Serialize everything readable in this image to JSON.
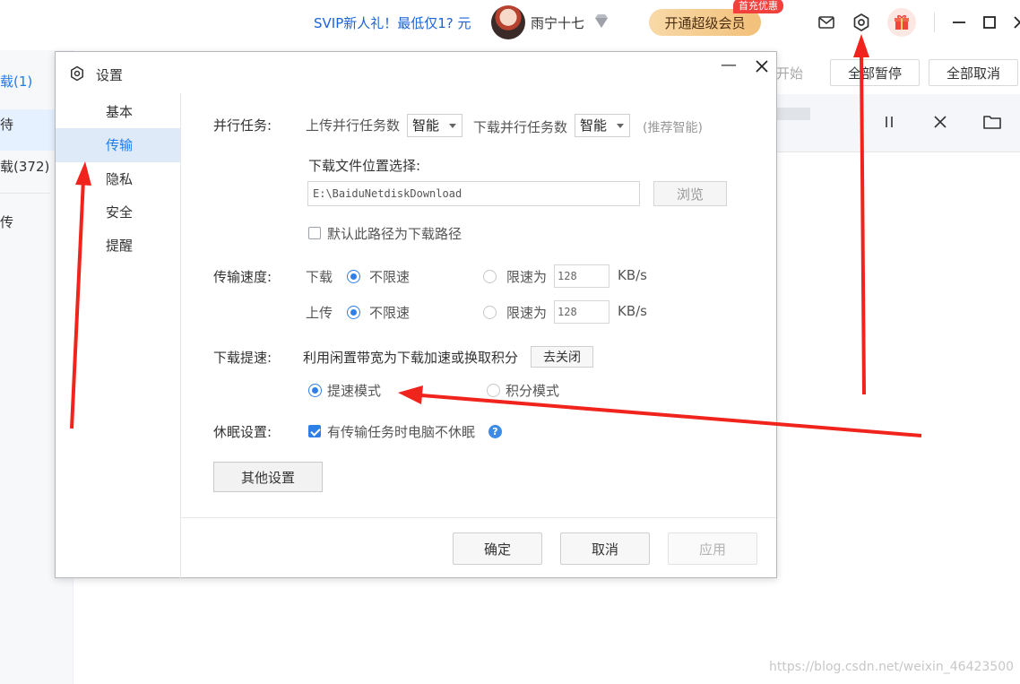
{
  "topbar": {
    "promo_text": "SVIP新人礼！最低仅1? 元",
    "username": "雨宁十七",
    "vip_button_label": "开通超级会员",
    "vip_badge": "首充优惠",
    "icons": [
      "mail-icon",
      "settings-gear-icon",
      "gift-icon",
      "minimize-icon",
      "maximize-icon",
      "close-icon"
    ]
  },
  "main_nav": {
    "fragments": [
      "载(1)",
      "待",
      "载(372)",
      "传"
    ]
  },
  "transfer_toolbar": {
    "start_label": "开始",
    "pause_all_label": "全部暂停",
    "cancel_all_label": "全部取消"
  },
  "dialog": {
    "title": "设置",
    "minimize_glyph": "—",
    "sidebar": [
      {
        "label": "基本",
        "active": false
      },
      {
        "label": "传输",
        "active": true
      },
      {
        "label": "隐私",
        "active": false
      },
      {
        "label": "安全",
        "active": false
      },
      {
        "label": "提醒",
        "active": false
      }
    ],
    "parallel": {
      "label": "并行任务:",
      "upload_label": "上传并行任务数",
      "upload_value": "智能",
      "download_label": "下载并行任务数",
      "download_value": "智能",
      "hint": "(推荐智能)"
    },
    "location": {
      "title": "下载文件位置选择:",
      "path": "E:\\BaiduNetdiskDownload",
      "browse_label": "浏览",
      "default_checkbox_label": "默认此路径为下载路径",
      "default_checked": false
    },
    "speed": {
      "label": "传输速度:",
      "rows": [
        {
          "direction": "下载",
          "unlimited_label": "不限速",
          "limit_label": "限速为",
          "limit_value": "128",
          "unit": "KB/s",
          "unlimited_selected": true
        },
        {
          "direction": "上传",
          "unlimited_label": "不限速",
          "limit_label": "限速为",
          "limit_value": "128",
          "unit": "KB/s",
          "unlimited_selected": true
        }
      ]
    },
    "boost": {
      "label": "下载提速:",
      "description": "利用闲置带宽为下载加速或换取积分",
      "go_close_label": "去关闭",
      "mode_fast_label": "提速模式",
      "mode_points_label": "积分模式",
      "mode_selected": "fast"
    },
    "sleep": {
      "label": "休眠设置:",
      "checkbox_label": "有传输任务时电脑不休眠",
      "checked": true,
      "help_glyph": "?"
    },
    "other_settings_label": "其他设置",
    "footer": {
      "ok_label": "确定",
      "cancel_label": "取消",
      "apply_label": "应用",
      "apply_enabled": false
    }
  },
  "annotation_color": "#f0241d",
  "watermark": "https://blog.csdn.net/weixin_46423500"
}
